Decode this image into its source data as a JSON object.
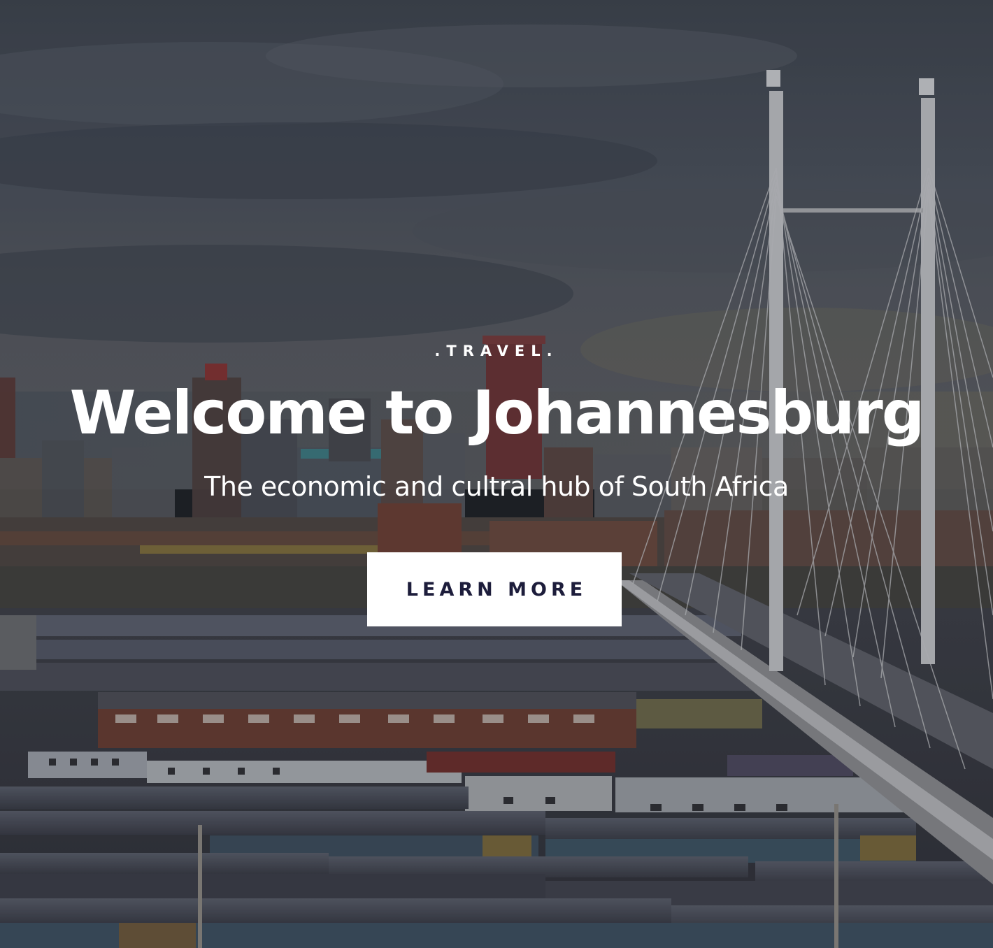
{
  "hero": {
    "kicker": ".TRAVEL.",
    "title": "Welcome to Johannesburg",
    "subtitle": "The economic and cultral hub of South Africa",
    "cta_label": "LEARN MORE"
  },
  "colors": {
    "text": "#ffffff",
    "button_background": "#ffffff",
    "button_text": "#1d1d3b",
    "sky": "#4a5160",
    "building_brick": "#6d3a36"
  },
  "background_image": {
    "scene": "johannesburg-skyline-bridge-train-yard"
  }
}
